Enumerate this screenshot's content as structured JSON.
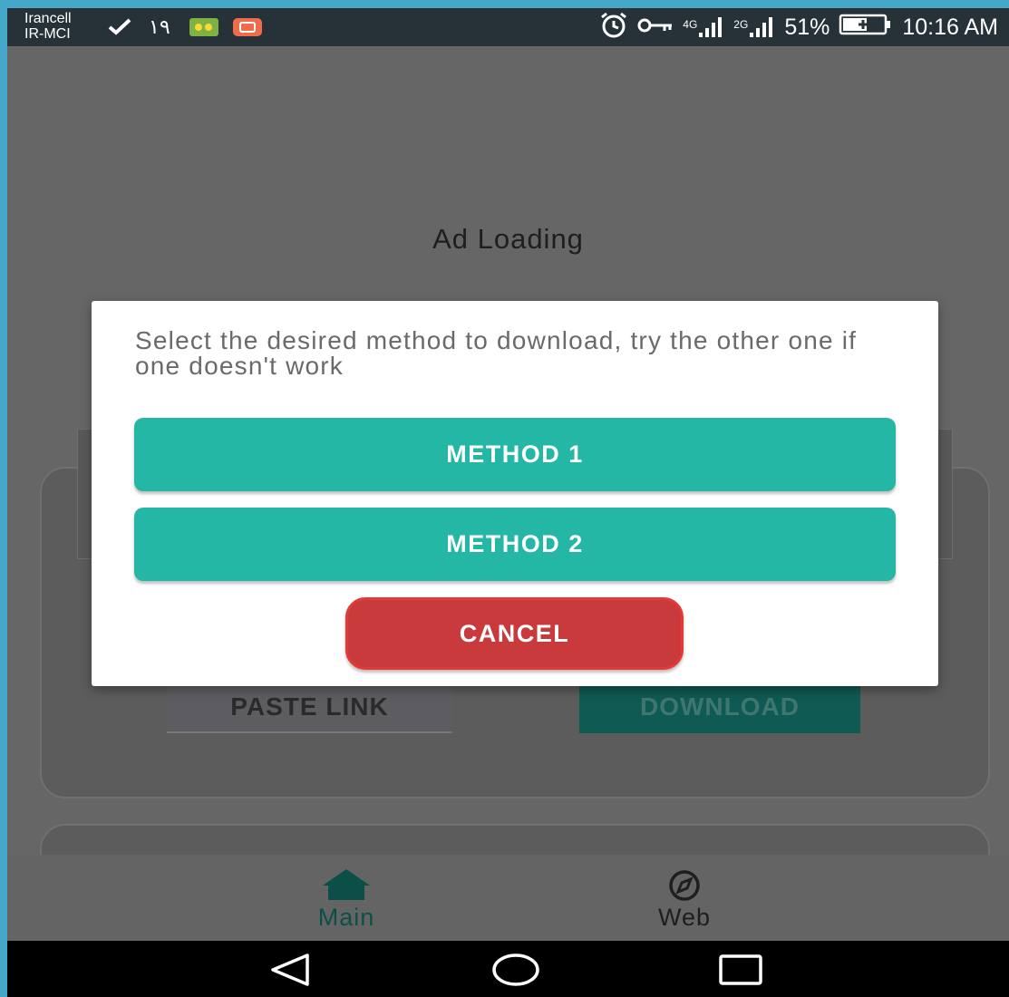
{
  "status_bar": {
    "carrier_1": "Irancell",
    "carrier_2": "IR-MCI",
    "notification_count": "۱۹",
    "net_1": "4G",
    "net_2": "2G",
    "battery": "51%",
    "time": "10:16 AM"
  },
  "background": {
    "ad_loading": "Ad Loading",
    "paste_link_label": "PASTE LINK",
    "download_label": "DOWNLOAD"
  },
  "dialog": {
    "message": "Select the desired method to download, try the other one if one doesn't work",
    "method1_label": "METHOD 1",
    "method2_label": "METHOD 2",
    "cancel_label": "CANCEL"
  },
  "bottom_nav": {
    "items": [
      {
        "label": "Main",
        "icon": "home-icon",
        "active": true
      },
      {
        "label": "Web",
        "icon": "compass-icon",
        "active": false
      }
    ]
  },
  "colors": {
    "accent": "#24b7a5",
    "cancel": "#c83a3c",
    "active_nav": "#0c4f48",
    "page_border": "#45a8c8"
  }
}
